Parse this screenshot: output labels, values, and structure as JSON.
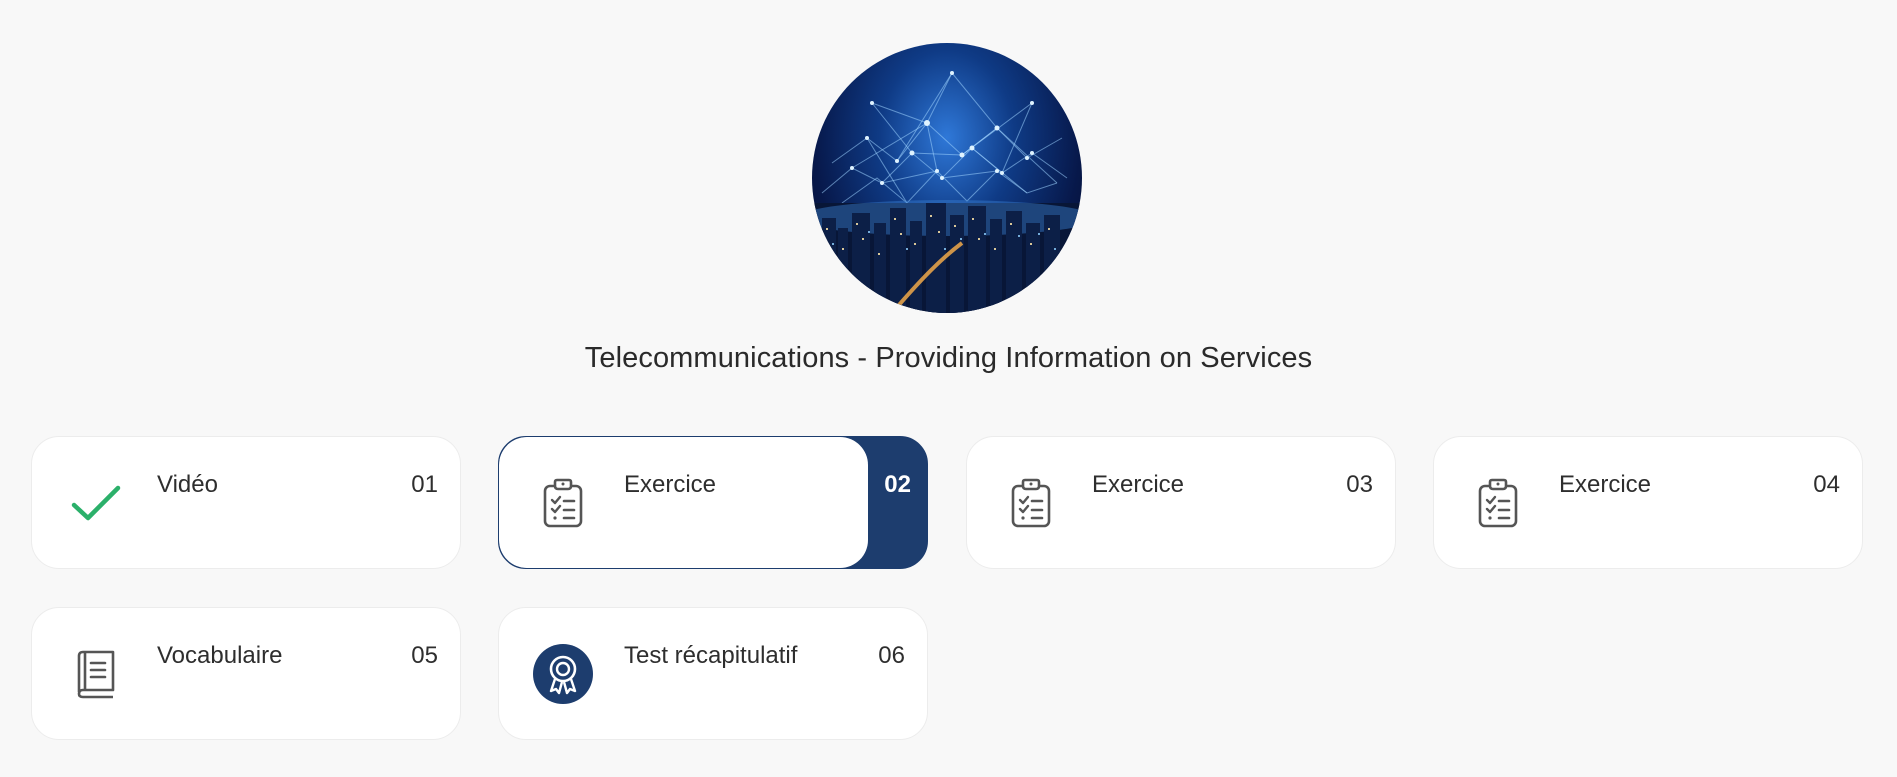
{
  "course": {
    "title": "Telecommunications - Providing Information on Services",
    "image_description_icon": "city-network-illustration"
  },
  "colors": {
    "accent": "#1d3d6e",
    "check": "#2bb06a",
    "icon": "#555555",
    "background": "#f8f8f8"
  },
  "steps": [
    {
      "label": "Vidéo",
      "number": "01",
      "icon": "check-icon",
      "completed": true
    },
    {
      "label": "Exercice",
      "number": "02",
      "icon": "clipboard-icon",
      "active": true
    },
    {
      "label": "Exercice",
      "number": "03",
      "icon": "clipboard-icon"
    },
    {
      "label": "Exercice",
      "number": "04",
      "icon": "clipboard-icon"
    },
    {
      "label": "Vocabulaire",
      "number": "05",
      "icon": "book-icon"
    },
    {
      "label": "Test récapitulatif",
      "number": "06",
      "icon": "award-badge-icon"
    }
  ]
}
